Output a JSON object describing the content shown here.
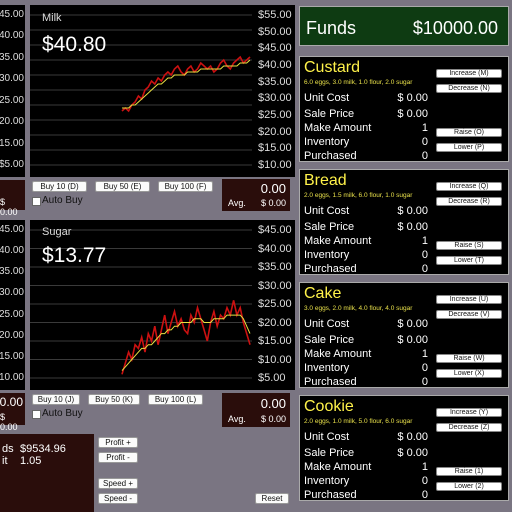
{
  "milk": {
    "name": "Milk",
    "price": "$40.80",
    "ticks": [
      "$55.00",
      "$50.00",
      "$45.00",
      "$40.00",
      "$35.00",
      "$30.00",
      "$25.00",
      "$20.00",
      "$15.00",
      "$10.00"
    ],
    "left_ticks": [
      "45.00",
      "40.00",
      "35.00",
      "30.00",
      "25.00",
      "20.00",
      "15.00",
      "$5.00"
    ],
    "buy_buttons": [
      "Buy 10 (D)",
      "Buy 50 (E)",
      "Buy 100 (F)"
    ],
    "auto_buy": "Auto Buy",
    "avg_value": "0.00",
    "avg_label": "Avg.",
    "avg_price": "$ 0.00",
    "left_partial": "$ 0.00"
  },
  "sugar": {
    "name": "Sugar",
    "price": "$13.77",
    "ticks": [
      "$45.00",
      "$40.00",
      "$35.00",
      "$30.00",
      "$25.00",
      "$20.00",
      "$15.00",
      "$10.00",
      "$5.00"
    ],
    "left_ticks": [
      "45.00",
      "40.00",
      "35.00",
      "30.00",
      "25.00",
      "20.00",
      "15.00",
      "10.00"
    ],
    "buy_buttons": [
      "Buy 10 (J)",
      "Buy 50 (K)",
      "Buy 100 (L)"
    ],
    "auto_buy": "Auto Buy",
    "avg_value": "0.00",
    "avg_label": "Avg.",
    "avg_price": "$ 0.00",
    "left_partial_top": "0.00",
    "left_partial": "$ 0.00"
  },
  "funds": {
    "label": "Funds",
    "value": "$10000.00"
  },
  "bottom": {
    "funds_partial": "ds",
    "funds_value": "$9534.96",
    "it_partial": "it",
    "it_value": "1.05",
    "buttons": [
      "Profit +",
      "Profit -",
      "Speed +",
      "Speed -",
      "Reset"
    ]
  },
  "products": [
    {
      "name": "Custard",
      "recipe": "6.0 eggs, 3.0 milk, 1.0 flour, 2.0 sugar",
      "unit_cost": "$ 0.00",
      "sale_price": "$ 0.00",
      "make_amount": "1",
      "inventory": "0",
      "purchased": "0",
      "b1": "Increase (M)",
      "b2": "Decrease (N)",
      "b3": "Raise (O)",
      "b4": "Lower (P)"
    },
    {
      "name": "Bread",
      "recipe": "2.0 eggs, 1.5 milk, 6.0 flour, 1.0 sugar",
      "unit_cost": "$ 0.00",
      "sale_price": "$ 0.00",
      "make_amount": "1",
      "inventory": "0",
      "purchased": "0",
      "b1": "Increase (Q)",
      "b2": "Decrease (R)",
      "b3": "Raise (S)",
      "b4": "Lower (T)"
    },
    {
      "name": "Cake",
      "recipe": "3.0 eggs, 2.0 milk, 4.0 flour, 4.0 sugar",
      "unit_cost": "$ 0.00",
      "sale_price": "$ 0.00",
      "make_amount": "1",
      "inventory": "0",
      "purchased": "0",
      "b1": "Increase (U)",
      "b2": "Decrease (V)",
      "b3": "Raise (W)",
      "b4": "Lower (X)"
    },
    {
      "name": "Cookie",
      "recipe": "2.0 eggs, 1.0 milk, 5.0 flour, 6.0 sugar",
      "unit_cost": "$ 0.00",
      "sale_price": "$ 0.00",
      "make_amount": "1",
      "inventory": "0",
      "purchased": "0",
      "b1": "Increase (Y)",
      "b2": "Decrease (Z)",
      "b3": "Raise (1)",
      "b4": "Lower (2)"
    }
  ],
  "labels": {
    "unit_cost": "Unit Cost",
    "sale_price": "Sale Price",
    "make_amount": "Make Amount",
    "inventory": "Inventory",
    "purchased": "Purchased"
  },
  "colors": {
    "background": "#7a7582",
    "price_line": "#cc1111",
    "avg_line": "#e8e040",
    "funds_bg": "#0e3b12",
    "product_name": "#fff24a"
  },
  "chart_data": [
    {
      "type": "line",
      "title": "Milk",
      "ylim": [
        5,
        55
      ],
      "grid": true,
      "series": [
        {
          "values": [
            23,
            24,
            23,
            25,
            26,
            28,
            27,
            30,
            31,
            33,
            32,
            34,
            33,
            35,
            36,
            35,
            37,
            38,
            36,
            35,
            37,
            38,
            36,
            37,
            39,
            38,
            37,
            38,
            36,
            37,
            39,
            40,
            38,
            37,
            39,
            40,
            41,
            39,
            40,
            41
          ]
        },
        {
          "values": [
            24,
            24,
            24,
            25,
            25,
            26,
            27,
            28,
            29,
            30,
            31,
            32,
            32,
            33,
            34,
            34,
            35,
            35,
            35,
            35,
            36,
            36,
            36,
            36,
            37,
            37,
            37,
            37,
            37,
            37,
            37,
            38,
            38,
            38,
            38,
            38,
            39,
            39,
            39,
            40
          ]
        }
      ]
    },
    {
      "type": "line",
      "title": "Sugar",
      "ylim": [
        5,
        45
      ],
      "grid": true,
      "series": [
        {
          "values": [
            6,
            9,
            12,
            10,
            14,
            13,
            16,
            12,
            17,
            15,
            19,
            14,
            18,
            22,
            17,
            20,
            23,
            19,
            21,
            18,
            17,
            22,
            20,
            24,
            21,
            18,
            15,
            20,
            23,
            19,
            22,
            21,
            24,
            22,
            26,
            22,
            24,
            20,
            17,
            14
          ]
        },
        {
          "values": [
            7,
            8,
            9,
            10,
            11,
            12,
            13,
            13,
            14,
            14,
            15,
            16,
            17,
            17,
            18,
            18,
            19,
            19,
            20,
            20,
            20,
            20,
            21,
            21,
            21,
            20,
            20,
            20,
            21,
            21,
            21,
            21,
            22,
            22,
            22,
            22,
            22,
            21,
            19,
            17
          ]
        }
      ]
    }
  ]
}
